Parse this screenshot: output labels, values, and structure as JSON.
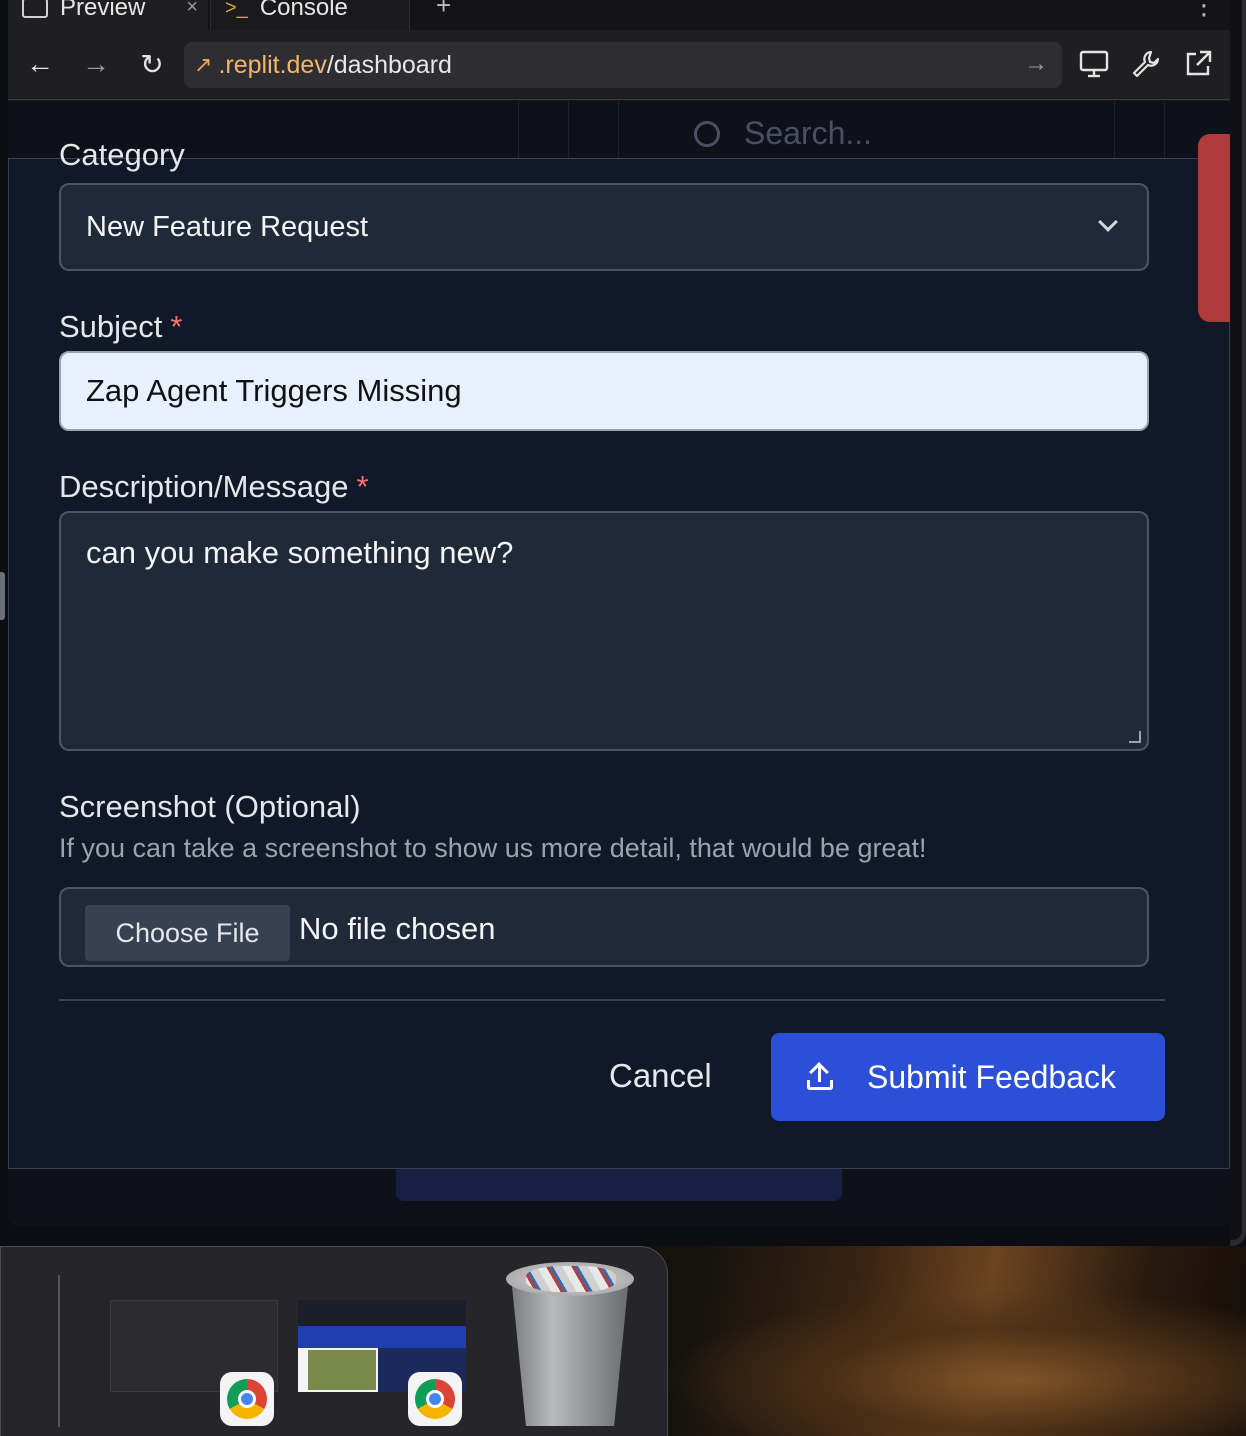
{
  "browser": {
    "tabs": [
      {
        "label": "Preview",
        "close": "×"
      },
      {
        "label": "Console"
      }
    ],
    "new_tab": "+",
    "more": "⋮",
    "nav": {
      "back": "←",
      "forward": "→",
      "reload": "↻"
    },
    "url": {
      "host": ".replit.dev",
      "path": "/dashboard",
      "go": "→"
    },
    "tools": {
      "devices": "🖵",
      "wrench": "🔧",
      "external": "↗"
    }
  },
  "background_app": {
    "search_placeholder": "Search..."
  },
  "form": {
    "category_label": "Category",
    "category_value": "New Feature Request",
    "subject_label": "Subject",
    "subject_value": "Zap Agent Triggers Missing",
    "description_label": "Description/Message",
    "description_value": "can you make something new?",
    "required_mark": "*",
    "screenshot_label": "Screenshot (Optional)",
    "screenshot_hint": "If you can take a screenshot to show us more detail, that would be great!",
    "choose_file": "Choose File",
    "no_file": "No file chosen",
    "cancel": "Cancel",
    "submit": "Submit Feedback"
  },
  "colors": {
    "accent": "#2b4fd6",
    "required": "#f87171",
    "modal_bg": "#111827",
    "url_host": "#f2b56b"
  }
}
